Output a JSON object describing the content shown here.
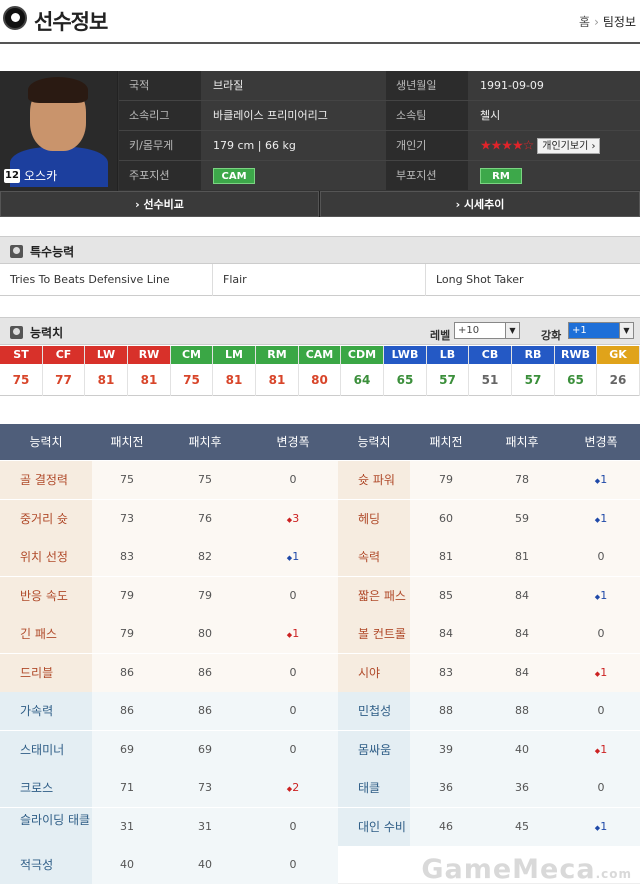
{
  "header": {
    "title": "선수정보",
    "breadcrumb": [
      "홈",
      "팀정보"
    ]
  },
  "player": {
    "number": "12",
    "name": "오스카",
    "labels": {
      "nationality": "국적",
      "birth": "생년월일",
      "league": "소속리그",
      "club": "소속팀",
      "body": "키/몸무게",
      "popularity": "개인기",
      "main_pos": "주포지션",
      "sub_pos": "부포지션"
    },
    "nationality": "브라질",
    "birth": "1991-09-09",
    "league": "바클레이스 프리미어리그",
    "club": "첼시",
    "body": "179 cm | 66 kg",
    "stars": "★★★★☆",
    "skill_button": "개인기보기 ›",
    "main_pos": "CAM",
    "sub_pos": "RM"
  },
  "buttons": {
    "compare": "› 선수비교",
    "trend": "› 시세추이"
  },
  "traits_section": {
    "title": "특수능력",
    "items": [
      "Tries To Beats Defensive Line",
      "Flair",
      "Long Shot Taker"
    ]
  },
  "ability_section": {
    "title": "능력치",
    "level_label": "레벨",
    "level_value": "+10",
    "enhance_label": "강화",
    "enhance_value": "+1"
  },
  "colors": {
    "fw": "#d8312a",
    "mf": "#3aa745",
    "df": "#2459c5",
    "gk": "#e0a31a"
  },
  "positions": [
    {
      "name": "ST",
      "value": "75",
      "group": "fw"
    },
    {
      "name": "CF",
      "value": "77",
      "group": "fw"
    },
    {
      "name": "LW",
      "value": "81",
      "group": "fw"
    },
    {
      "name": "RW",
      "value": "81",
      "group": "fw"
    },
    {
      "name": "CM",
      "value": "75",
      "group": "mf"
    },
    {
      "name": "LM",
      "value": "81",
      "group": "mf"
    },
    {
      "name": "RM",
      "value": "81",
      "group": "mf"
    },
    {
      "name": "CAM",
      "value": "80",
      "group": "mf"
    },
    {
      "name": "CDM",
      "value": "64",
      "group": "mf"
    },
    {
      "name": "LWB",
      "value": "65",
      "group": "df"
    },
    {
      "name": "LB",
      "value": "57",
      "group": "df"
    },
    {
      "name": "CB",
      "value": "51",
      "group": "df"
    },
    {
      "name": "RB",
      "value": "57",
      "group": "df"
    },
    {
      "name": "RWB",
      "value": "65",
      "group": "df"
    },
    {
      "name": "GK",
      "value": "26",
      "group": "gk"
    }
  ],
  "stats_headers": [
    "능력치",
    "패치전",
    "패치후",
    "변경폭",
    "능력치",
    "패치전",
    "패치후",
    "변경폭"
  ],
  "stats_rows": [
    {
      "tone": "warm",
      "l": [
        "골 결정력",
        "75",
        "75",
        "0",
        ""
      ],
      "r": [
        "슛 파워",
        "79",
        "78",
        "1",
        "dn"
      ]
    },
    {
      "tone": "warm",
      "l": [
        "중거리 슛",
        "73",
        "76",
        "3",
        "up"
      ],
      "r": [
        "헤딩",
        "60",
        "59",
        "1",
        "dn"
      ]
    },
    {
      "tone": "warm",
      "l": [
        "위치 선정",
        "83",
        "82",
        "1",
        "dn"
      ],
      "r": [
        "속력",
        "81",
        "81",
        "0",
        ""
      ]
    },
    {
      "tone": "warm",
      "l": [
        "반응 속도",
        "79",
        "79",
        "0",
        ""
      ],
      "r": [
        "짧은 패스",
        "85",
        "84",
        "1",
        "dn"
      ]
    },
    {
      "tone": "warm",
      "l": [
        "긴 패스",
        "79",
        "80",
        "1",
        "up"
      ],
      "r": [
        "볼 컨트롤",
        "84",
        "84",
        "0",
        ""
      ]
    },
    {
      "tone": "warm",
      "l": [
        "드리블",
        "86",
        "86",
        "0",
        ""
      ],
      "r": [
        "시야",
        "83",
        "84",
        "1",
        "up"
      ]
    },
    {
      "tone": "cool",
      "l": [
        "가속력",
        "86",
        "86",
        "0",
        ""
      ],
      "r": [
        "민첩성",
        "88",
        "88",
        "0",
        ""
      ]
    },
    {
      "tone": "cool",
      "l": [
        "스태미너",
        "69",
        "69",
        "0",
        ""
      ],
      "r": [
        "몸싸움",
        "39",
        "40",
        "1",
        "up"
      ]
    },
    {
      "tone": "cool",
      "l": [
        "크로스",
        "71",
        "73",
        "2",
        "up"
      ],
      "r": [
        "태클",
        "36",
        "36",
        "0",
        ""
      ]
    },
    {
      "tone": "cool",
      "l": [
        "슬라이딩 태클",
        "31",
        "31",
        "0",
        ""
      ],
      "r": [
        "대인 수비",
        "46",
        "45",
        "1",
        "dn"
      ]
    },
    {
      "tone": "cool",
      "l": [
        "적극성",
        "40",
        "40",
        "0",
        ""
      ],
      "r": []
    }
  ],
  "watermark": {
    "brand": "GameMeca",
    "suffix": ".com"
  }
}
